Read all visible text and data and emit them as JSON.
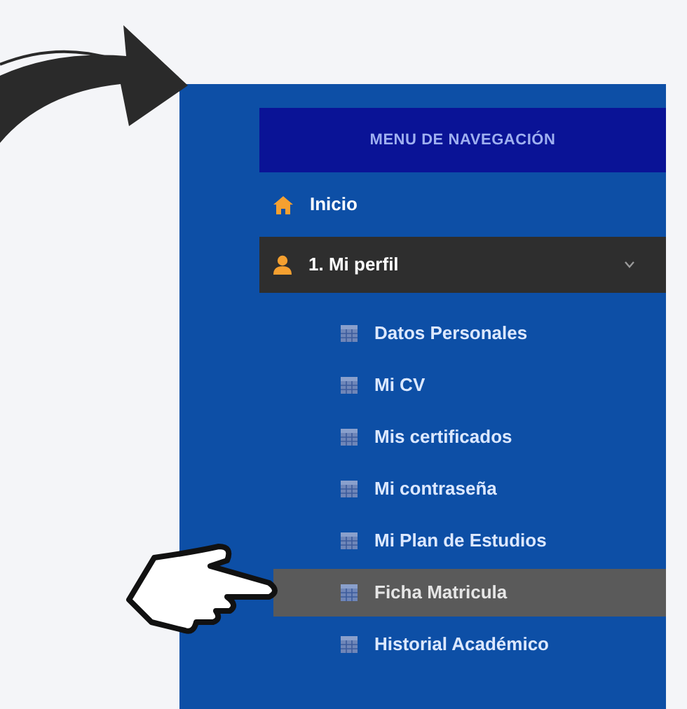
{
  "sidebar": {
    "header": "MENU DE NAVEGACIÓN",
    "items": [
      {
        "label": "Inicio",
        "kind": "link",
        "expanded": false
      },
      {
        "label": "1. Mi perfil",
        "kind": "group",
        "expanded": true,
        "children": [
          {
            "label": "Datos Personales",
            "selected": false
          },
          {
            "label": "Mi CV",
            "selected": false
          },
          {
            "label": "Mis certificados",
            "selected": false
          },
          {
            "label": "Mi contraseña",
            "selected": false
          },
          {
            "label": "Mi Plan de Estudios",
            "selected": false
          },
          {
            "label": "Ficha Matricula",
            "selected": true
          },
          {
            "label": "Historial Académico",
            "selected": false
          }
        ]
      }
    ]
  }
}
